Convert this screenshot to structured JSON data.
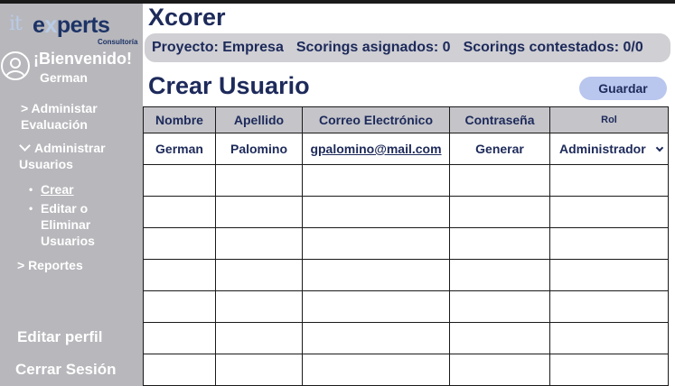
{
  "logo": {
    "it": "it",
    "experts_a": "e",
    "experts_x": "x",
    "experts_b": "perts",
    "sub": "Consultoría"
  },
  "sidebar": {
    "welcome": "¡Bienvenido!",
    "username": "German",
    "admin_eval": "> Administar Evaluación",
    "admin_users": "Administrar Usuarios",
    "sub_crear": "Crear",
    "sub_editar": "Editar o Eliminar Usuarios",
    "bullet": "•",
    "reportes": "> Reportes",
    "edit_profile": "Editar perfil",
    "logout": "Cerrar Sesión"
  },
  "header": {
    "app_title": "Xcorer",
    "project": "Proyecto: Empresa",
    "scorings_assigned": "Scorings asignados: 0",
    "scorings_answered": "Scorings contestados: 0/0"
  },
  "main": {
    "page_title": "Crear Usuario",
    "save_label": "Guardar"
  },
  "table": {
    "columns": [
      "Nombre",
      "Apellido",
      "Correo Electrónico",
      "Contraseña",
      "Rol"
    ],
    "row": {
      "nombre": "German",
      "apellido": "Palomino",
      "correo": "gpalomino@mail.com",
      "contrasena": "Generar",
      "rol": "Administrador"
    }
  },
  "colors": {
    "sidebar": "#b7b7bc",
    "brand_navy": "#1d2a5a",
    "button_bg": "#b9c6ee",
    "header_bar": "#cfcfd4"
  }
}
